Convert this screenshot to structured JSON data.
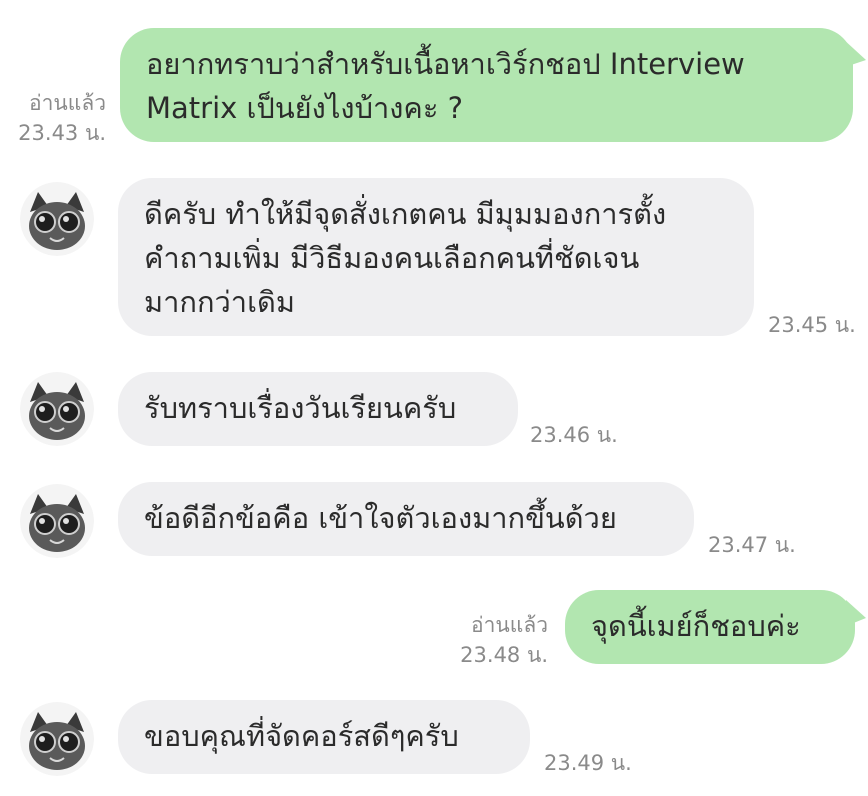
{
  "messages": [
    {
      "side": "out",
      "text": "อยากทราบว่าสำหรับเนื้อหาเวิร์กชอป Interview\nMatrix เป็นยังไงบ้างคะ ?",
      "read": "อ่านแล้ว",
      "time": "23.43 น."
    },
    {
      "side": "in",
      "text": "ดีครับ ทำให้มีจุดสั่งเกตคน มีมุมมองการตั้ง\nคำถามเพิ่ม มีวิธีมองคนเลือกคนที่ชัดเจน\nมากกว่าเดิม",
      "time": "23.45 น."
    },
    {
      "side": "in",
      "text": "รับทราบเรื่องวันเรียนครับ",
      "time": "23.46 น."
    },
    {
      "side": "in",
      "text": "ข้อดีอีกข้อคือ เข้าใจตัวเองมากขึ้นด้วย",
      "time": "23.47 น."
    },
    {
      "side": "out",
      "text": "จุดนี้เมย์ก็ชอบค่ะ",
      "read": "อ่านแล้ว",
      "time": "23.48 น."
    },
    {
      "side": "in",
      "text": "ขอบคุณที่จัดคอร์สดีๆครับ",
      "time": "23.49 น."
    }
  ],
  "colors": {
    "outgoing_bubble": "#b2e6b0",
    "incoming_bubble": "#efeff1",
    "meta_text": "#8a8a8a",
    "message_text": "#2b2b2b"
  },
  "icons": {
    "avatar": "cat-with-goggles-avatar-icon"
  }
}
